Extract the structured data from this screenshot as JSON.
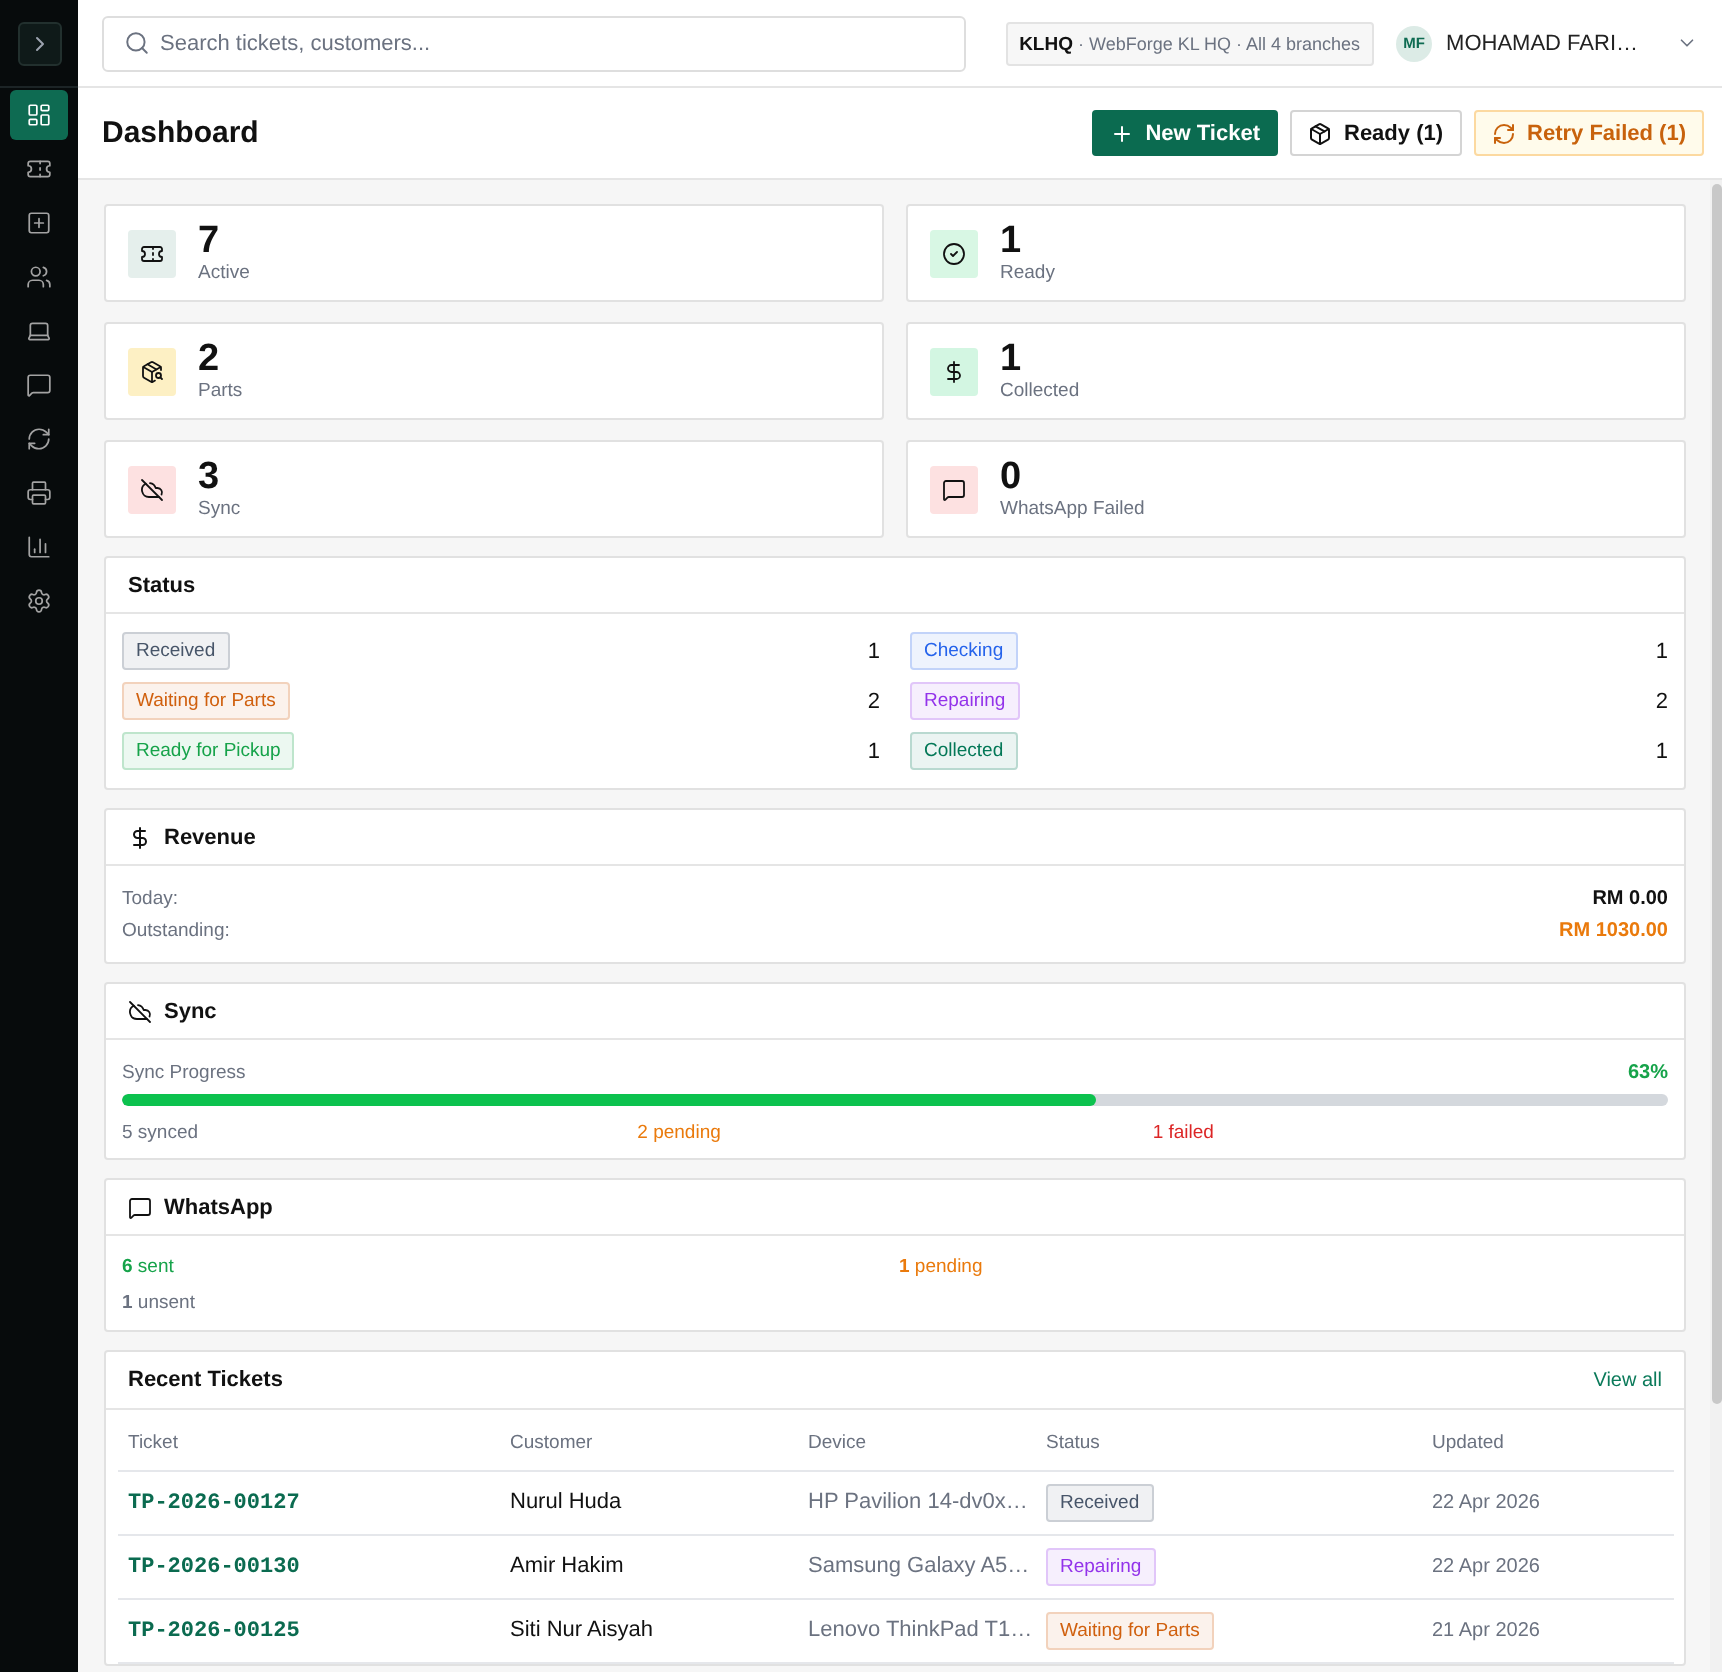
{
  "sidebar": {
    "items": [
      {
        "selected": true
      },
      {
        "selected": false
      },
      {
        "selected": false
      },
      {
        "selected": false
      },
      {
        "selected": false
      },
      {
        "selected": false
      },
      {
        "selected": false
      },
      {
        "selected": false
      },
      {
        "selected": false
      },
      {
        "selected": false
      }
    ]
  },
  "search": {
    "placeholder": "Search tickets, customers..."
  },
  "branch": "**KLHQ** · WebForge KL HQ · All 4 branches",
  "user": {
    "initials": "MF",
    "name": "MOHAMAD FARI…"
  },
  "page": {
    "title": "Dashboard",
    "actions": [
      {
        "kind": "primary",
        "label": "New Ticket"
      },
      {
        "kind": "outline",
        "label": "Ready (1)"
      },
      {
        "kind": "warning",
        "label": "Retry Failed (1)"
      }
    ]
  },
  "stats": [
    {
      "value": "7",
      "label": "Active",
      "color": "#e5efec"
    },
    {
      "value": "1",
      "label": "Ready",
      "color": "#d8f7e4"
    },
    {
      "value": "2",
      "label": "Parts",
      "color": "#fdf0c4"
    },
    {
      "value": "1",
      "label": "Collected",
      "color": "#d3f6e2"
    },
    {
      "value": "3",
      "label": "Sync",
      "color": "#fde1e1"
    },
    {
      "value": "0",
      "label": "WhatsApp Failed",
      "color": "#fde1e1"
    }
  ],
  "status": {
    "title": "Status",
    "items": [
      {
        "label": "Received",
        "count": "1",
        "color": "#475569"
      },
      {
        "label": "Checking",
        "count": "1",
        "color": "#2563eb"
      },
      {
        "label": "Waiting for Parts",
        "count": "2",
        "color": "#d0600e"
      },
      {
        "label": "Repairing",
        "count": "2",
        "color": "#9333ea"
      },
      {
        "label": "Ready for Pickup",
        "count": "1",
        "color": "#16a34a"
      },
      {
        "label": "Collected",
        "count": "1",
        "color": "#047857"
      }
    ]
  },
  "revenue": {
    "title": "Revenue",
    "rows": [
      {
        "label": "Today:",
        "value": "RM 0.00",
        "color": "#111111"
      },
      {
        "label": "Outstanding:",
        "value": "RM 1030.00",
        "color": "#ea7a0c"
      }
    ]
  },
  "sync": {
    "title": "Sync",
    "progress": {
      "label": "Sync Progress",
      "reading": "63%",
      "level": 0.63
    },
    "counts": [
      {
        "text": "5 synced",
        "color": "#6b7280"
      },
      {
        "text": "2 pending",
        "color": "#ea7a0c"
      },
      {
        "text": "1 failed",
        "color": "#dc2626"
      }
    ]
  },
  "whatsapp": {
    "title": "WhatsApp",
    "counts": [
      {
        "text": "**6** sent",
        "color": "#16a34a"
      },
      {
        "text": "**1** pending",
        "color": "#ea7a0c"
      },
      {
        "text": "**1** unsent",
        "color": "#6b7280"
      }
    ]
  },
  "recent_tickets": {
    "title": "Recent Tickets",
    "link": "View all",
    "columns": [
      "Ticket",
      "Customer",
      "Device",
      "Status",
      "Updated"
    ],
    "rows": [
      {
        "ticket": "TP-2026-00127",
        "customer": "Nurul Huda",
        "device": "HP Pavilion 14-dv0x…",
        "status": {
          "label": "Received",
          "color": "#475569"
        },
        "updated": "22 Apr 2026"
      },
      {
        "ticket": "TP-2026-00130",
        "customer": "Amir Hakim",
        "device": "Samsung Galaxy A5…",
        "status": {
          "label": "Repairing",
          "color": "#9333ea"
        },
        "updated": "22 Apr 2026"
      },
      {
        "ticket": "TP-2026-00125",
        "customer": "Siti Nur Aisyah",
        "device": "Lenovo ThinkPad T1…",
        "status": {
          "label": "Waiting for Parts",
          "color": "#d0600e"
        },
        "updated": "21 Apr 2026"
      }
    ]
  }
}
